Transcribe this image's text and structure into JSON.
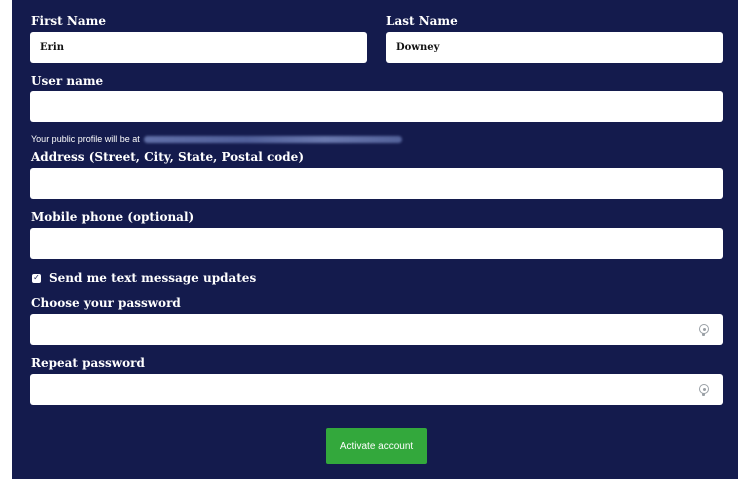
{
  "form": {
    "first_name": {
      "label": "First Name",
      "value": "Erin"
    },
    "last_name": {
      "label": "Last Name",
      "value": "Downey"
    },
    "username": {
      "label": "User name",
      "value": ""
    },
    "profile_hint": "Your public profile will be at",
    "address": {
      "label": "Address (Street, City, State, Postal code)",
      "value": ""
    },
    "mobile": {
      "label": "Mobile phone (optional)",
      "value": ""
    },
    "sms_updates": {
      "label": "Send me text message updates",
      "checked": true,
      "check_glyph": "✓"
    },
    "password": {
      "label": "Choose your password",
      "value": "",
      "icon": "eye-icon"
    },
    "repeat_password": {
      "label": "Repeat password",
      "value": "",
      "icon": "eye-icon"
    },
    "submit_label": "Activate account"
  },
  "colors": {
    "panel_background": "#141b4d",
    "submit_button": "#33a83c",
    "field_background": "#ffffff"
  }
}
